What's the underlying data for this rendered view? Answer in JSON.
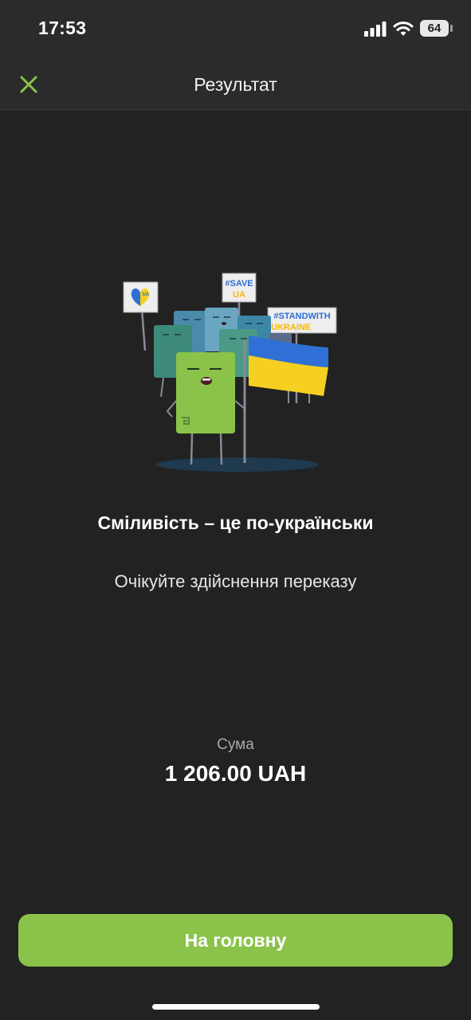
{
  "status_bar": {
    "time": "17:53",
    "battery": "64",
    "icons": [
      "signal-icon",
      "wifi-icon",
      "battery-icon"
    ]
  },
  "header": {
    "title": "Результат",
    "close_icon": "close-icon"
  },
  "illustration": {
    "signs": {
      "heart": "UA",
      "save_line1": "#SAVE",
      "save_line2": "UA",
      "stand_line1": "#STANDWITH",
      "stand_line2": "UKRAINE"
    }
  },
  "main": {
    "headline": "Сміливість – це по-українськи",
    "subtitle": "Очікуйте здійснення переказу",
    "amount_label": "Сума",
    "amount_value": "1 206.00 UAH"
  },
  "footer": {
    "home_button_label": "На головну"
  },
  "colors": {
    "background": "#222222",
    "accent": "#8bc34a",
    "flag_blue": "#2f6fd6",
    "flag_yellow": "#f5d020"
  }
}
